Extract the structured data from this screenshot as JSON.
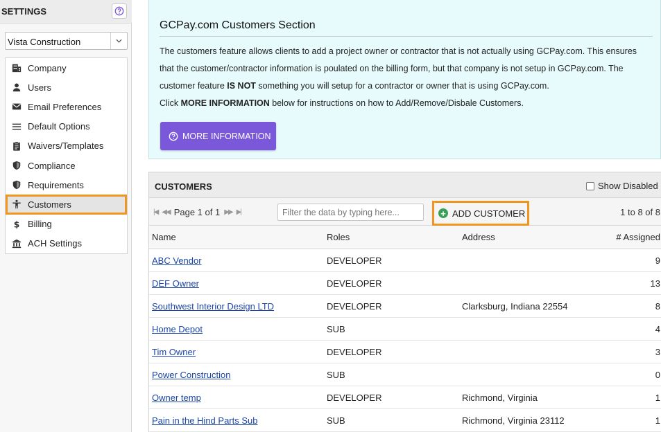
{
  "sidebar": {
    "title": "SETTINGS",
    "company": "Vista Construction",
    "items": [
      {
        "label": "Company",
        "icon": "building-icon"
      },
      {
        "label": "Users",
        "icon": "user-icon"
      },
      {
        "label": "Email Preferences",
        "icon": "envelope-icon"
      },
      {
        "label": "Default Options",
        "icon": "menu-lines-icon"
      },
      {
        "label": "Waivers/Templates",
        "icon": "clipboard-icon"
      },
      {
        "label": "Compliance",
        "icon": "shield-icon"
      },
      {
        "label": "Requirements",
        "icon": "shield-icon"
      },
      {
        "label": "Customers",
        "icon": "person-arms-icon",
        "active": true
      },
      {
        "label": "Billing",
        "icon": "dollar-icon"
      },
      {
        "label": "ACH Settings",
        "icon": "bank-icon"
      }
    ]
  },
  "info": {
    "title": "GCPay.com Customers Section",
    "p1": "The customers feature allows clients to add a project owner or contractor that is not actually using GCPay.com. This ensures that the customer/contractor information is poulated on the billing form, but that company is not setup in GCPay.com. The customer feature ",
    "p1_bold": "IS NOT",
    "p1_end": " something you will setup for a contractor or owner that is using GCPay.com.",
    "p2": "Click ",
    "p2_bold": "MORE INFORMATION",
    "p2_end": " below for instructions on how to Add/Remove/Disbale Customers.",
    "button": "MORE INFORMATION"
  },
  "grid": {
    "title": "CUSTOMERS",
    "show_disabled": "Show Disabled",
    "pager": "Page 1 of 1",
    "filter_placeholder": "Filter the data by typing here...",
    "add_button": "ADD CUSTOMER",
    "count": "1 to 8 of 8",
    "columns": [
      "Name",
      "Roles",
      "Address",
      "# Assigned"
    ],
    "rows": [
      {
        "name": "ABC Vendor",
        "role": "DEVELOPER",
        "address": "",
        "assigned": "9"
      },
      {
        "name": "DEF Owner",
        "role": "DEVELOPER",
        "address": "",
        "assigned": "13"
      },
      {
        "name": "Southwest Interior Design LTD",
        "role": "DEVELOPER",
        "address": "Clarksburg, Indiana 22554",
        "assigned": "8"
      },
      {
        "name": "Home Depot",
        "role": "SUB",
        "address": "",
        "assigned": "4"
      },
      {
        "name": "Tim Owner",
        "role": "DEVELOPER",
        "address": "",
        "assigned": "3"
      },
      {
        "name": "Power Construction",
        "role": "SUB",
        "address": "",
        "assigned": "0"
      },
      {
        "name": "Owner temp",
        "role": "DEVELOPER",
        "address": "Richmond, Virginia",
        "assigned": "1"
      },
      {
        "name": "Pain in the Hind Parts Sub",
        "role": "SUB",
        "address": "Richmond, Virginia 23112",
        "assigned": "1"
      }
    ]
  }
}
